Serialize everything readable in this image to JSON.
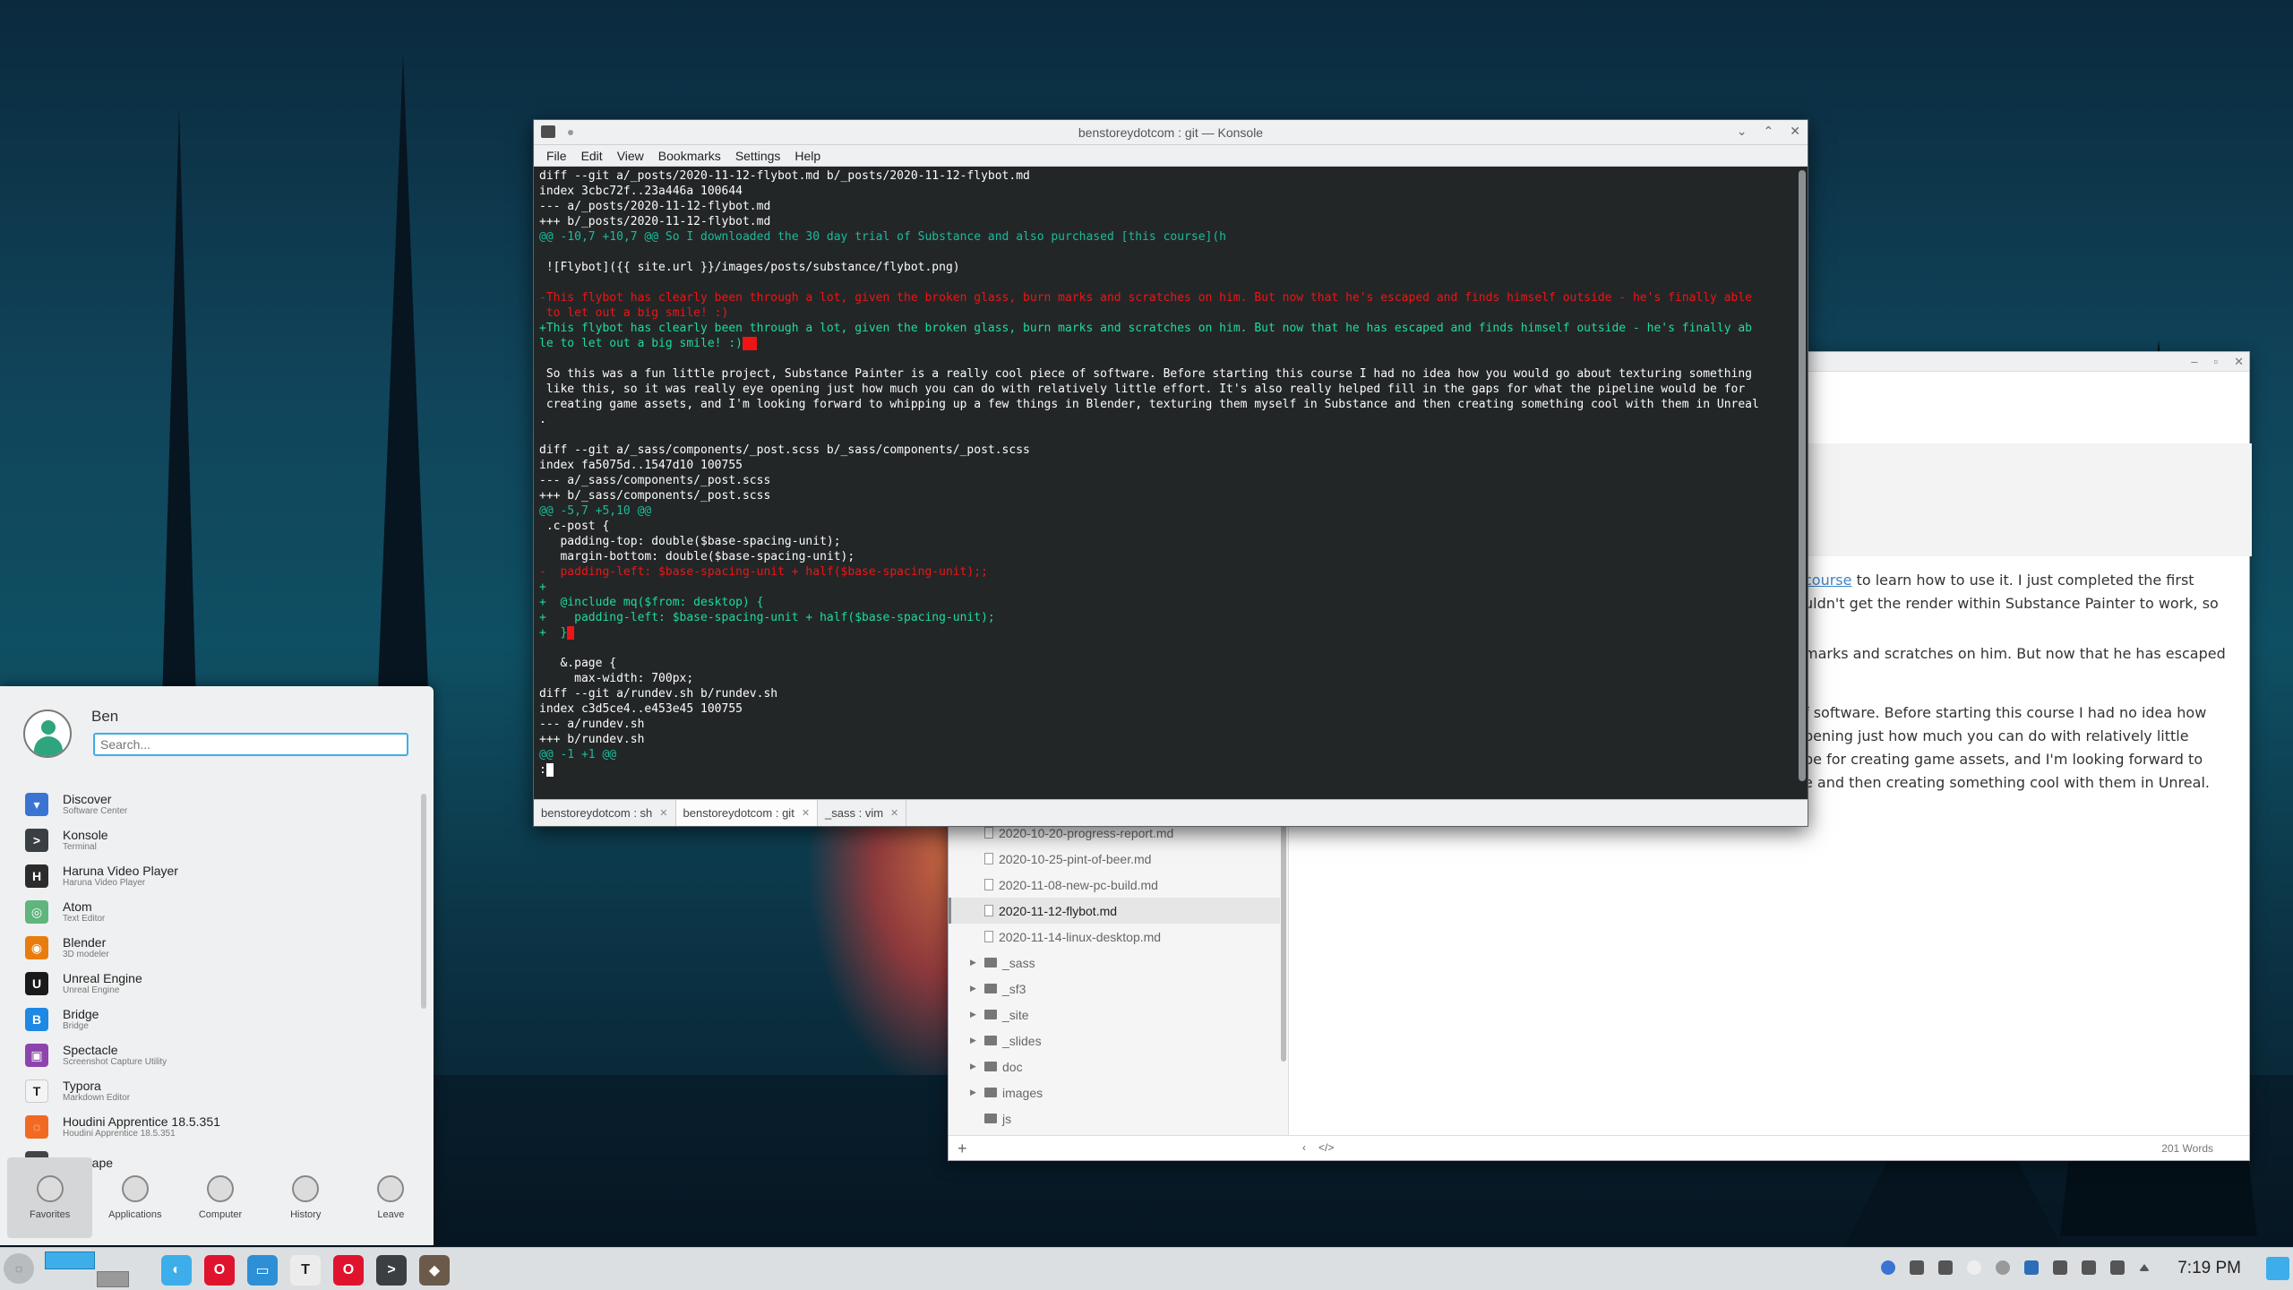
{
  "konsole": {
    "title": "benstoreydotcom : git — Konsole",
    "menu": [
      "File",
      "Edit",
      "View",
      "Bookmarks",
      "Settings",
      "Help"
    ],
    "tabs": [
      {
        "label": "benstoreydotcom : sh",
        "active": false
      },
      {
        "label": "benstoreydotcom : git",
        "active": true
      },
      {
        "label": "_sass : vim",
        "active": false
      }
    ],
    "tab_close": "✕",
    "lines": [
      {
        "t": "diff --git a/_posts/2020-11-12-flybot.md b/_posts/2020-11-12-flybot.md",
        "c": ""
      },
      {
        "t": "index 3cbc72f..23a446a 100644",
        "c": ""
      },
      {
        "t": "--- a/_posts/2020-11-12-flybot.md",
        "c": ""
      },
      {
        "t": "+++ b/_posts/2020-11-12-flybot.md",
        "c": ""
      },
      {
        "t": "@@ -10,7 +10,7 @@ So I downloaded the 30 day trial of Substance and also purchased [this course](h",
        "c": "hunk"
      },
      {
        "t": "",
        "c": ""
      },
      {
        "t": " ![Flybot]({{ site.url }}/images/posts/substance/flybot.png)",
        "c": ""
      },
      {
        "t": "",
        "c": ""
      },
      {
        "t": "-This flybot has clearly been through a lot, given the broken glass, burn marks and scratches on him. But now that he's escaped and finds himself outside - he's finally able",
        "c": "del"
      },
      {
        "t": " to let out a big smile! :)",
        "c": "del"
      },
      {
        "t": "+This flybot has clearly been through a lot, given the broken glass, burn marks and scratches on him. But now that he has escaped and finds himself outside - he's finally ab",
        "c": "add"
      },
      {
        "t": "le to let out a big smile! :)",
        "c": "add",
        "cursor": "^M"
      },
      {
        "t": "",
        "c": ""
      },
      {
        "t": " So this was a fun little project, Substance Painter is a really cool piece of software. Before starting this course I had no idea how you would go about texturing something",
        "c": ""
      },
      {
        "t": " like this, so it was really eye opening just how much you can do with relatively little effort. It's also really helped fill in the gaps for what the pipeline would be for",
        "c": ""
      },
      {
        "t": " creating game assets, and I'm looking forward to whipping up a few things in Blender, texturing them myself in Substance and then creating something cool with them in Unreal",
        "c": ""
      },
      {
        "t": ".",
        "c": ""
      },
      {
        "t": "",
        "c": ""
      },
      {
        "t": "diff --git a/_sass/components/_post.scss b/_sass/components/_post.scss",
        "c": ""
      },
      {
        "t": "index fa5075d..1547d10 100755",
        "c": ""
      },
      {
        "t": "--- a/_sass/components/_post.scss",
        "c": ""
      },
      {
        "t": "+++ b/_sass/components/_post.scss",
        "c": ""
      },
      {
        "t": "@@ -5,7 +5,10 @@",
        "c": "hunk"
      },
      {
        "t": " .c-post {",
        "c": ""
      },
      {
        "t": "   padding-top: double($base-spacing-unit);",
        "c": ""
      },
      {
        "t": "   margin-bottom: double($base-spacing-unit);",
        "c": ""
      },
      {
        "t": "-  padding-left: $base-spacing-unit + half($base-spacing-unit);;",
        "c": "del"
      },
      {
        "t": "+",
        "c": "add"
      },
      {
        "t": "+  @include mq($from: desktop) {",
        "c": "add"
      },
      {
        "t": "+    padding-left: $base-spacing-unit + half($base-spacing-unit);",
        "c": "add"
      },
      {
        "t": "+  }",
        "c": "add",
        "cursor": " "
      },
      {
        "t": "",
        "c": ""
      },
      {
        "t": "   &.page {",
        "c": ""
      },
      {
        "t": "     max-width: 700px;",
        "c": ""
      },
      {
        "t": "diff --git a/rundev.sh b/rundev.sh",
        "c": ""
      },
      {
        "t": "index c3d5ce4..e453e45 100755",
        "c": ""
      },
      {
        "t": "--- a/rundev.sh",
        "c": ""
      },
      {
        "t": "+++ b/rundev.sh",
        "c": ""
      },
      {
        "t": "@@ -1 +1 @@",
        "c": "hunk"
      },
      {
        "t": ":",
        "c": "",
        "cursor2": " "
      }
    ]
  },
  "editor": {
    "files": [
      {
        "name": "2020-10-20-progress-report.md",
        "active": false
      },
      {
        "name": "2020-10-25-pint-of-beer.md",
        "active": false
      },
      {
        "name": "2020-11-08-new-pc-build.md",
        "active": false
      },
      {
        "name": "2020-11-12-flybot.md",
        "active": true
      },
      {
        "name": "2020-11-14-linux-desktop.md",
        "active": false
      }
    ],
    "folders": [
      {
        "name": "_sass",
        "arrow": "▶"
      },
      {
        "name": "_sf3",
        "arrow": "▶"
      },
      {
        "name": "_site",
        "arrow": "▶"
      },
      {
        "name": "_slides",
        "arrow": "▶"
      },
      {
        "name": "doc",
        "arrow": "▶"
      },
      {
        "name": "images",
        "arrow": "▶"
      },
      {
        "name": "js",
        "arrow": ""
      }
    ],
    "text": {
      "p1_link": "course",
      "p1_a": " to learn how to use it. I just completed the first",
      "p1_b": "uldn't get the render within Substance Painter to work, so",
      "p2_a": "marks and scratches on him. But now that he has escaped",
      "p3_a": "f software. Before starting this course I had no idea how",
      "p3_b": "pening just how much you can do with relatively little",
      "p3_c": "be for creating game assets, and I'm looking forward to",
      "p3_d": "e and then creating something cool with them in Unreal."
    },
    "footer": {
      "add": "+",
      "back": "‹",
      "code": "</>",
      "words": "201 Words"
    },
    "window_controls": [
      "–",
      "▫",
      "✕"
    ]
  },
  "launcher": {
    "user": "Ben",
    "search_placeholder": "Search...",
    "apps": [
      {
        "name": "Discover",
        "desc": "Software Center",
        "color": "#3b73d3",
        "glyph": "▾"
      },
      {
        "name": "Konsole",
        "desc": "Terminal",
        "color": "#3a3f44",
        "glyph": ">"
      },
      {
        "name": "Haruna Video Player",
        "desc": "Haruna Video Player",
        "color": "#2c2c2c",
        "glyph": "H"
      },
      {
        "name": "Atom",
        "desc": "Text Editor",
        "color": "#5fb57d",
        "glyph": "◎"
      },
      {
        "name": "Blender",
        "desc": "3D modeler",
        "color": "#e87d0d",
        "glyph": "◉"
      },
      {
        "name": "Unreal Engine",
        "desc": "Unreal Engine",
        "color": "#1a1a1a",
        "glyph": "U"
      },
      {
        "name": "Bridge",
        "desc": "Bridge",
        "color": "#1e88e5",
        "glyph": "B"
      },
      {
        "name": "Spectacle",
        "desc": "Screenshot Capture Utility",
        "color": "#8e44ad",
        "glyph": "▣"
      },
      {
        "name": "Typora",
        "desc": "Markdown Editor",
        "color": "#f4f4f4",
        "glyph": "T"
      },
      {
        "name": "Houdini Apprentice 18.5.351",
        "desc": "Houdini Apprentice 18.5.351",
        "color": "#f26a21",
        "glyph": "◌"
      },
      {
        "name": "Inkscape",
        "desc": "",
        "color": "#444",
        "glyph": "△"
      }
    ],
    "tabs": [
      {
        "label": "Favorites",
        "active": true
      },
      {
        "label": "Applications",
        "active": false
      },
      {
        "label": "Computer",
        "active": false
      },
      {
        "label": "History",
        "active": false
      },
      {
        "label": "Leave",
        "active": false
      }
    ]
  },
  "konsole_controls": [
    "⌄",
    "⌃",
    "✕"
  ],
  "taskbar": {
    "clock": "7:19 PM",
    "apps": [
      {
        "name": "browser",
        "color": "#3daee9",
        "glyph": "◐"
      },
      {
        "name": "opera",
        "color": "#e0132e",
        "glyph": "O"
      },
      {
        "name": "files",
        "color": "#2d8fd6",
        "glyph": "▭"
      },
      {
        "name": "typora",
        "color": "#ececec",
        "glyph": "T"
      },
      {
        "name": "opera-gx",
        "color": "#e0132e",
        "glyph": "O"
      },
      {
        "name": "konsole",
        "color": "#3a3f44",
        "glyph": ">"
      },
      {
        "name": "gimp",
        "color": "#6b5a4a",
        "glyph": "◆"
      }
    ]
  }
}
